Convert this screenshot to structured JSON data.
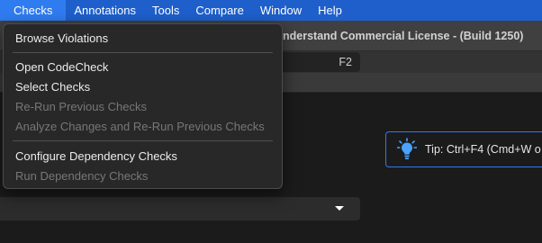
{
  "menubar": {
    "items": [
      "Checks",
      "Annotations",
      "Tools",
      "Compare",
      "Window",
      "Help"
    ]
  },
  "window": {
    "title": "nderstand Commercial License - (Build 1250)"
  },
  "shortcut_field": {
    "value": "F2"
  },
  "tip": {
    "text": "Tip: Ctrl+F4 (Cmd+W o"
  },
  "checks_menu": {
    "items": [
      {
        "label": "Browse Violations",
        "enabled": true
      },
      {
        "label": "Open CodeCheck",
        "enabled": true
      },
      {
        "label": "Select Checks",
        "enabled": true
      },
      {
        "label": "Re-Run Previous Checks",
        "enabled": false
      },
      {
        "label": "Analyze Changes and Re-Run Previous Checks",
        "enabled": false
      },
      {
        "label": "Configure Dependency Checks",
        "enabled": true
      },
      {
        "label": "Run Dependency Checks",
        "enabled": false
      }
    ]
  },
  "colors": {
    "menubar_bg": "#1e5fcb",
    "menubar_active": "#2f7bf0",
    "tip_border": "#2d79f2",
    "bulb": "#4aa3ff"
  },
  "icons": {
    "tip": "lightbulb-icon",
    "combo": "caret-down-icon"
  }
}
